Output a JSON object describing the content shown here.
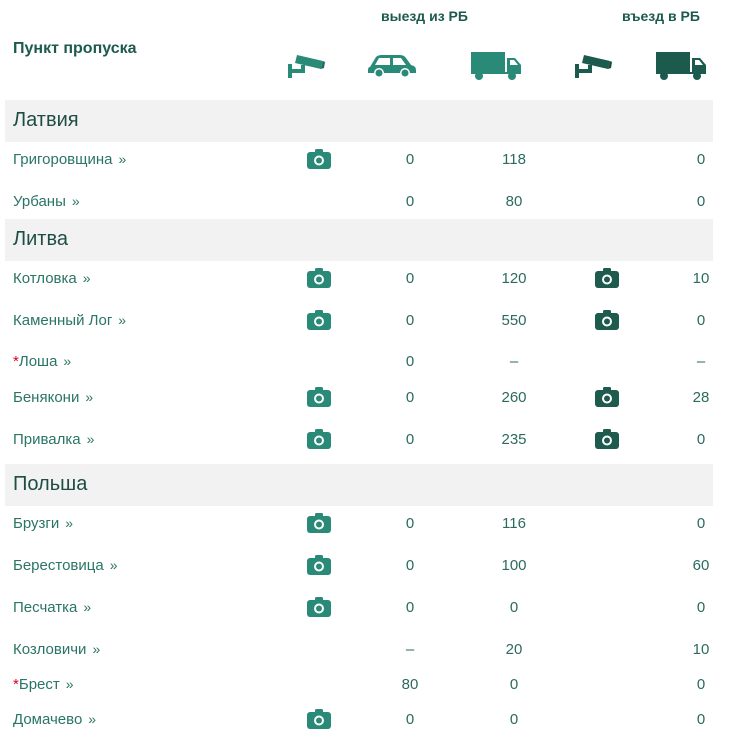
{
  "header": {
    "checkpoint_label": "Пункт пропуска",
    "exit_label": "выезд из РБ",
    "entry_label": "въезд в РБ",
    "icons": [
      "camera-icon",
      "car-icon",
      "truck-icon",
      "camera-icon",
      "truck-icon"
    ]
  },
  "colors": {
    "accent": "#2a8a78",
    "dark_accent": "#1e5a4e",
    "country_bg": "#f2f2f2"
  },
  "countries": [
    {
      "name": "Латвия",
      "rows": [
        {
          "name": "Григоровщина",
          "star": "",
          "exit_camera": true,
          "car": "0",
          "truck": "118",
          "entry_camera": false,
          "entry_truck": "0"
        },
        {
          "name": "Урбаны",
          "star": "",
          "exit_camera": false,
          "car": "0",
          "truck": "80",
          "entry_camera": false,
          "entry_truck": "0"
        }
      ]
    },
    {
      "name": "Литва",
      "rows": [
        {
          "name": "Котловка",
          "star": "",
          "exit_camera": true,
          "car": "0",
          "truck": "120",
          "entry_camera": true,
          "entry_truck": "10"
        },
        {
          "name": "Каменный Лог",
          "star": "",
          "exit_camera": true,
          "car": "0",
          "truck": "550",
          "entry_camera": true,
          "entry_truck": "0"
        },
        {
          "name": "Лоша",
          "star": "*",
          "exit_camera": false,
          "car": "0",
          "truck": "–",
          "entry_camera": false,
          "entry_truck": "–"
        },
        {
          "name": "Бенякони",
          "star": "",
          "exit_camera": true,
          "car": "0",
          "truck": "260",
          "entry_camera": true,
          "entry_truck": "28"
        },
        {
          "name": "Привалка",
          "star": "",
          "exit_camera": true,
          "car": "0",
          "truck": "235",
          "entry_camera": true,
          "entry_truck": "0"
        }
      ]
    },
    {
      "name": "Польша",
      "rows": [
        {
          "name": "Брузги",
          "star": "",
          "exit_camera": true,
          "car": "0",
          "truck": "116",
          "entry_camera": false,
          "entry_truck": "0"
        },
        {
          "name": "Берестовица",
          "star": "",
          "exit_camera": true,
          "car": "0",
          "truck": "100",
          "entry_camera": false,
          "entry_truck": "60"
        },
        {
          "name": "Песчатка",
          "star": "",
          "exit_camera": true,
          "car": "0",
          "truck": "0",
          "entry_camera": false,
          "entry_truck": "0"
        },
        {
          "name": "Козловичи",
          "star": "",
          "exit_camera": false,
          "car": "–",
          "truck": "20",
          "entry_camera": false,
          "entry_truck": "10"
        },
        {
          "name": "Брест",
          "star": "*",
          "exit_camera": false,
          "car": "80",
          "truck": "0",
          "entry_camera": false,
          "entry_truck": "0"
        },
        {
          "name": "Домачево",
          "star": "",
          "exit_camera": true,
          "car": "0",
          "truck": "0",
          "entry_camera": false,
          "entry_truck": "0"
        }
      ]
    }
  ]
}
